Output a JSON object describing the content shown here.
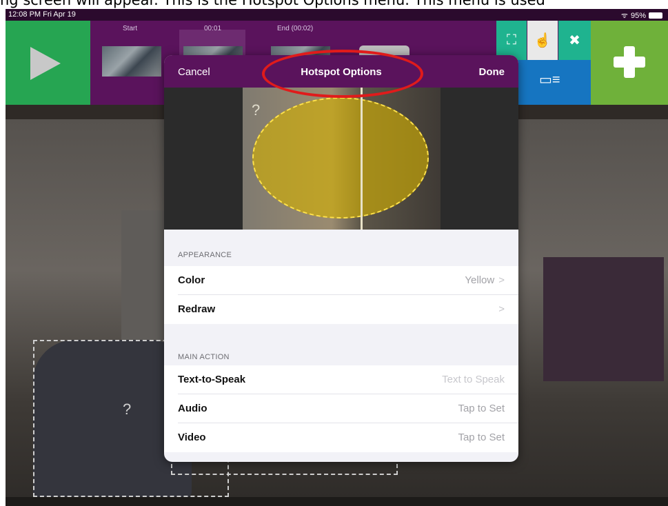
{
  "caption": "ng screen will appear. This is the Hotspot Options menu. This menu is used",
  "status_bar": {
    "time": "12:08 PM  Fri Apr 19",
    "battery": "95%"
  },
  "timeline": {
    "start_label": "Start",
    "current_label": "00:01",
    "end_label": "End (00:02)"
  },
  "toolbar": {
    "play_icon": "play-icon",
    "tools": [
      "resize-icon",
      "touch-icon",
      "close-icon",
      "image-text-icon"
    ],
    "add_icon": "plus-icon"
  },
  "background_hotspot": {
    "label": "?"
  },
  "modal": {
    "cancel_label": "Cancel",
    "title": "Hotspot Options",
    "done_label": "Done",
    "preview_label": "?",
    "appearance": {
      "header": "APPEARANCE",
      "rows": [
        {
          "label": "Color",
          "value": "Yellow"
        },
        {
          "label": "Redraw",
          "value": ""
        }
      ]
    },
    "main_action": {
      "header": "MAIN ACTION",
      "rows": [
        {
          "label": "Text-to-Speak",
          "value": "Text to Speak"
        },
        {
          "label": "Audio",
          "value": "Tap to Set"
        },
        {
          "label": "Video",
          "value": "Tap to Set"
        }
      ]
    }
  },
  "colors": {
    "purple": "#5a135c",
    "green": "#26a552",
    "teal": "#1fb38f",
    "blue": "#1675c1",
    "lime": "#6fb13a",
    "hotspot_fill": "#d4b000",
    "annotation_red": "#e01b1b"
  }
}
